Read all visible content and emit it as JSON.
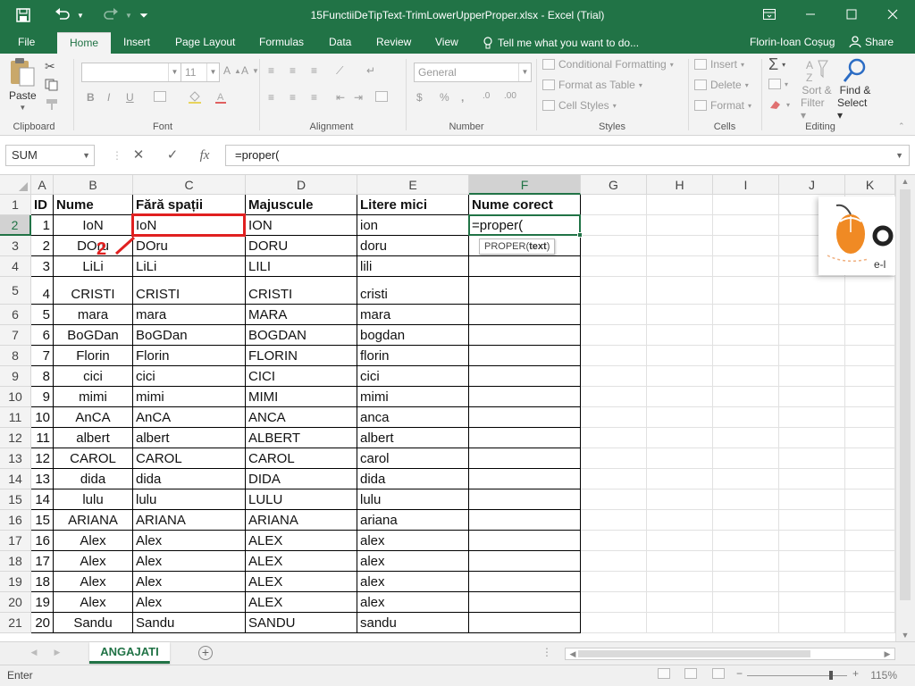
{
  "window": {
    "title": "15FunctiiDeTipText-TrimLowerUpperProper.xlsx - Excel (Trial)"
  },
  "ribbon_tabs": [
    "File",
    "Home",
    "Insert",
    "Page Layout",
    "Formulas",
    "Data",
    "Review",
    "View"
  ],
  "active_tab": "Home",
  "tell_me": "Tell me what you want to do...",
  "user": "Florin-Ioan Coșug",
  "share_label": "Share",
  "ribbon": {
    "paste_label": "Paste",
    "font_size": "11",
    "number_format": "General",
    "conditional_formatting": "Conditional Formatting",
    "format_as_table": "Format as Table",
    "cell_styles": "Cell Styles",
    "insert": "Insert",
    "delete": "Delete",
    "format": "Format",
    "sort_filter_1": "Sort &",
    "sort_filter_2": "Filter",
    "find_select_1": "Find &",
    "find_select_2": "Select",
    "groups": {
      "clipboard": "Clipboard",
      "font": "Font",
      "alignment": "Alignment",
      "number": "Number",
      "styles": "Styles",
      "cells": "Cells",
      "editing": "Editing"
    }
  },
  "formula_bar": {
    "name_box": "SUM",
    "formula": "=proper("
  },
  "columns": [
    "A",
    "B",
    "C",
    "D",
    "E",
    "F",
    "G",
    "H",
    "I",
    "J",
    "K"
  ],
  "rows": [
    [
      "ID",
      "Nume",
      "Fără spații",
      "Majuscule",
      "Litere mici",
      "Nume corect"
    ],
    [
      "1",
      "IoN",
      "IoN",
      "ION",
      "ion",
      "=proper("
    ],
    [
      "2",
      "DOru",
      "DOru",
      "DORU",
      "doru",
      ""
    ],
    [
      "3",
      "LiLi",
      "LiLi",
      "LILI",
      "lili",
      ""
    ],
    [
      "4",
      "CRISTI",
      "CRISTI",
      "CRISTI",
      "cristi",
      ""
    ],
    [
      "5",
      "mara",
      "mara",
      "MARA",
      "mara",
      ""
    ],
    [
      "6",
      "BoGDan",
      "BoGDan",
      "BOGDAN",
      "bogdan",
      ""
    ],
    [
      "7",
      "Florin",
      "Florin",
      "FLORIN",
      "florin",
      ""
    ],
    [
      "8",
      "cici",
      "cici",
      "CICI",
      "cici",
      ""
    ],
    [
      "9",
      "mimi",
      "mimi",
      "MIMI",
      "mimi",
      ""
    ],
    [
      "10",
      "AnCA",
      "AnCA",
      "ANCA",
      "anca",
      ""
    ],
    [
      "11",
      "albert",
      "albert",
      "ALBERT",
      "albert",
      ""
    ],
    [
      "12",
      "CAROL",
      "CAROL",
      "CAROL",
      "carol",
      ""
    ],
    [
      "13",
      "dida",
      "dida",
      "DIDA",
      "dida",
      ""
    ],
    [
      "14",
      "lulu",
      "lulu",
      "LULU",
      "lulu",
      ""
    ],
    [
      "15",
      "ARIANA",
      "ARIANA",
      "ARIANA",
      "ariana",
      ""
    ],
    [
      "16",
      "Alex",
      "Alex",
      "ALEX",
      "alex",
      ""
    ],
    [
      "17",
      "Alex",
      "Alex",
      "ALEX",
      "alex",
      ""
    ],
    [
      "18",
      "Alex",
      "Alex",
      "ALEX",
      "alex",
      ""
    ],
    [
      "19",
      "Alex",
      "Alex",
      "ALEX",
      "alex",
      ""
    ],
    [
      "20",
      "Sandu",
      "Sandu",
      "SANDU",
      "sandu",
      ""
    ]
  ],
  "tooltip": {
    "fn": "PROPER(",
    "arg": "text",
    "close": ")"
  },
  "annotation_number": "2",
  "sheet_tab": "ANGAJATI",
  "status": "Enter",
  "zoom": "115%",
  "colors": {
    "excel_green": "#217346",
    "annotation_red": "#e02020"
  }
}
